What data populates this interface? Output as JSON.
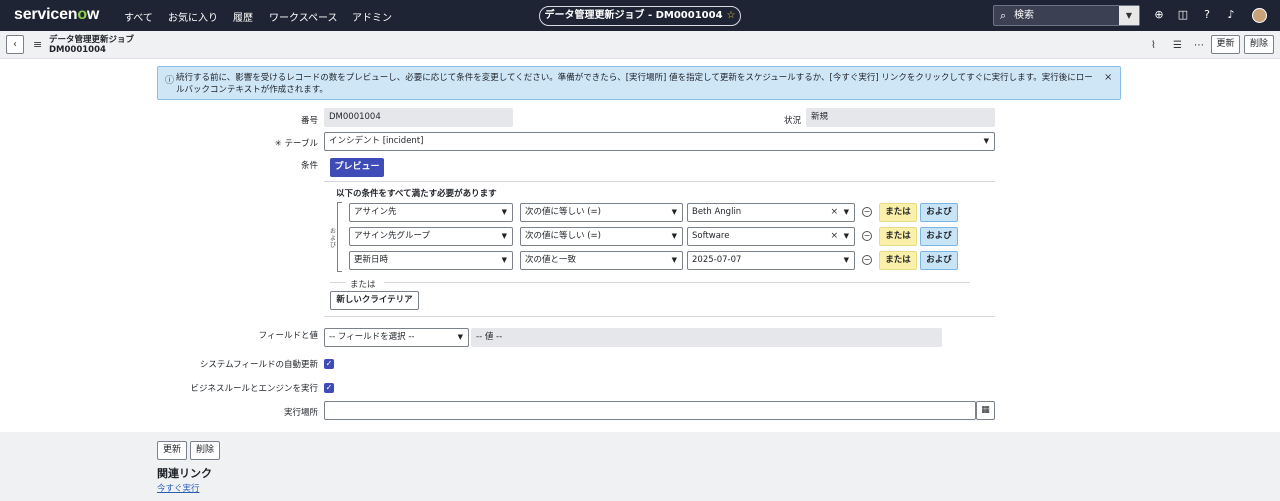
{
  "topnav": {
    "logo": "servicenow",
    "items": [
      "すべて",
      "お気に入り",
      "履歴",
      "ワークスペース",
      "アドミン"
    ],
    "title": "データ管理更新ジョブ - DM0001004",
    "search_placeholder": "検索",
    "icons": [
      "globe-icon",
      "chat-icon",
      "help-icon",
      "bell-icon",
      "avatar"
    ]
  },
  "header": {
    "title_line1": "データ管理更新ジョブ",
    "title_line2": "DM0001004",
    "update_label": "更新",
    "delete_label": "削除"
  },
  "info": {
    "text": "続行する前に、影響を受けるレコードの数をプレビューし、必要に応じて条件を変更してください。準備ができたら、[実行場所] 値を指定して更新をスケジュールするか、[今すぐ実行] リンクをクリックしてすぐに実行します。実行後にロールバックコンテキストが作成されます。"
  },
  "form": {
    "number_label": "番号",
    "number_value": "DM0001004",
    "status_label": "状況",
    "status_value": "新規",
    "table_label": "テーブル",
    "table_required": "✳",
    "table_value": "インシデント [incident]",
    "condition_label": "条件",
    "preview_label": "プレビュー",
    "condition_heading": "以下の条件をすべて満たす必要があります",
    "and_vertical": "および",
    "conditions": [
      {
        "field": "アサイン先",
        "operator": "次の値に等しい (=)",
        "value": "Beth Anglin",
        "or_label": "または",
        "and_label": "および"
      },
      {
        "field": "アサイン先グループ",
        "operator": "次の値に等しい (=)",
        "value": "Software",
        "or_label": "または",
        "and_label": "および"
      },
      {
        "field": "更新日時",
        "operator": "次の値と一致",
        "value": "2025-07-07",
        "or_label": "または",
        "and_label": "および"
      }
    ],
    "or_divider": "または",
    "new_criteria_label": "新しいクライテリア",
    "fields_label": "フィールドと値",
    "field_select_value": "-- フィールドを選択 --",
    "value_placeholder": "-- 値 --",
    "auto_update_label": "システムフィールドの自動更新",
    "auto_update_checked": true,
    "business_rules_label": "ビジネスルールとエンジンを実行",
    "business_rules_checked": true,
    "run_at_label": "実行場所",
    "run_at_value": ""
  },
  "footer": {
    "update_label": "更新",
    "delete_label": "削除",
    "related_links_title": "関連リンク",
    "run_now_link": "今すぐ実行"
  }
}
